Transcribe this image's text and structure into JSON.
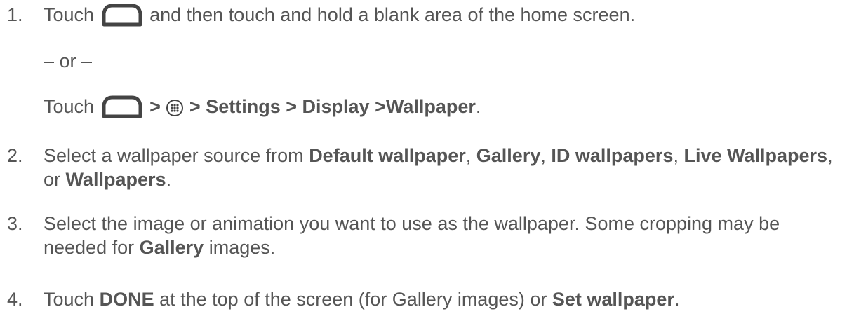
{
  "steps": [
    {
      "number": "1.",
      "intro": "Touch",
      "home_icon": "home-icon",
      "text": "and then touch and hold a blank area of the home screen.",
      "or_text": "– or –",
      "alt_intro": "Touch",
      "alt_home_icon": "home-icon",
      "sep1": ">",
      "apps_icon": "apps-icon",
      "sep2": ">",
      "path_settings": "Settings",
      "sep3": ">",
      "path_display": "Display",
      "sep4": ">",
      "path_wallpaper": "Wallpaper",
      "alt_end": "."
    },
    {
      "number": "2.",
      "t1": "Select a wallpaper source from",
      "b1": "Default wallpaper",
      "t2": ",",
      "b2": "Gallery",
      "t3": ",",
      "b3": "ID wallpapers",
      "t4": ",",
      "b4": "Live Wallpapers",
      "t5": ", or",
      "b5": "Wallpapers",
      "t6": "."
    },
    {
      "number": "3.",
      "t1": "Select the image or animation you want to use as the wallpaper. Some cropping may be needed for",
      "b1": "Gallery",
      "t2": "images."
    },
    {
      "number": "4.",
      "t1": "Touch",
      "b1": "DONE",
      "t2": "at the top of the screen (for Gallery images) or",
      "b2": "Set wallpaper",
      "t3": "."
    }
  ],
  "colors": {
    "text": "#555555",
    "icon": "#444444"
  }
}
